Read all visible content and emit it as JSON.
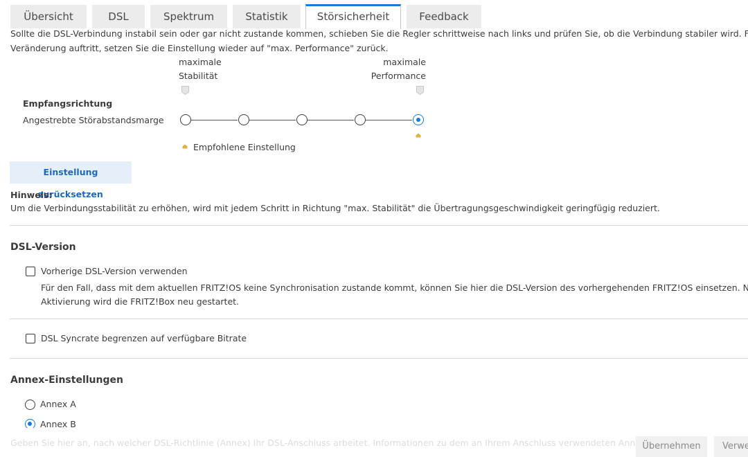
{
  "tabs": [
    {
      "label": "Übersicht"
    },
    {
      "label": "DSL"
    },
    {
      "label": "Spektrum"
    },
    {
      "label": "Statistik"
    },
    {
      "label": "Störsicherheit"
    },
    {
      "label": "Feedback"
    }
  ],
  "active_tab": "Störsicherheit",
  "intro": {
    "line1": "Sollte die DSL-Verbindung instabil sein oder gar nicht zustande kommen, schieben Sie die Regler schrittweise nach links und prüfen Sie, ob die Verbindung stabiler wird. Falls kei",
    "line2": "Veränderung auftritt, setzen Sie die Einstellung wieder auf \"max. Performance\" zurück."
  },
  "scale": {
    "left_line1": "maximale",
    "left_line2": "Stabilität",
    "right_line1": "maximale",
    "right_line2": "Performance"
  },
  "empfang": {
    "heading": "Empfangsrichtung",
    "row_label": "Angestrebte Störabstandsmarge",
    "steps": 5,
    "selected_step": 5,
    "recommended_step": 5,
    "recommended_label": "Empfohlene Einstellung"
  },
  "reset_button": "Einstellung zurücksetzen",
  "hint": {
    "title": "Hinweis:",
    "text": "Um die Verbindungsstabilität zu erhöhen, wird mit jedem Schritt in Richtung \"max. Stabilität\" die Übertragungsgeschwindigkeit geringfügig reduziert."
  },
  "dsl_version": {
    "title": "DSL-Version",
    "checkbox_label": "Vorherige DSL-Version verwenden",
    "checked": false,
    "desc_line1": "Für den Fall, dass mit dem aktuellen FRITZ!OS keine Synchronisation zustande kommt, können Sie hier die DSL-Version des vorhergehenden FRITZ!OS einsetzen. Nach der",
    "desc_line2": "Aktivierung wird die FRITZ!Box neu gestartet."
  },
  "syncrate": {
    "checkbox_label": "DSL Syncrate begrenzen auf verfügbare Bitrate",
    "checked": false
  },
  "annex": {
    "title": "Annex-Einstellungen",
    "options": [
      "Annex A",
      "Annex B"
    ],
    "selected": "Annex B",
    "faded_text": "Geben Sie hier an, nach welcher DSL-Richtlinie (Annex) Ihr DSL-Anschluss arbeitet. Informationen zu dem an Ihrem Anschluss verwendeten Annex erh"
  },
  "footer": {
    "apply_button": "Übernehmen",
    "discard_button": "Verwe"
  },
  "colors": {
    "accent": "#1a7bd6",
    "button_bg": "#e5eff9",
    "recommended_marker": "#e0b040"
  }
}
